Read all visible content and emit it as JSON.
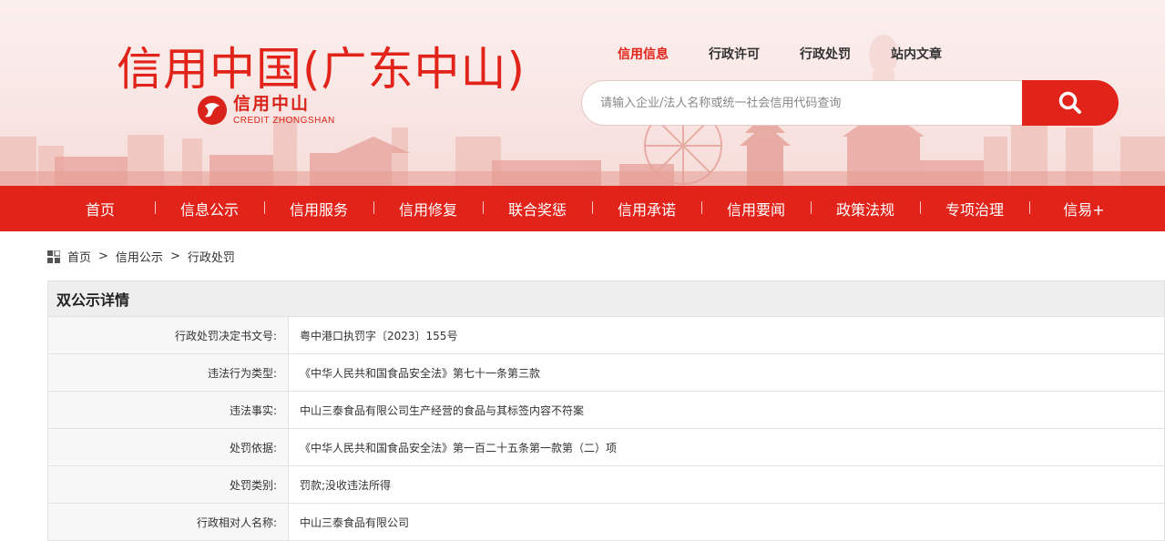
{
  "site": {
    "title": "信用中国(广东中山)",
    "logo_cn": "信用中山",
    "logo_en": "CREDIT ZHONGSHAN"
  },
  "top_nav": [
    {
      "label": "信用信息",
      "active": true
    },
    {
      "label": "行政许可",
      "active": false
    },
    {
      "label": "行政处罚",
      "active": false
    },
    {
      "label": "站内文章",
      "active": false
    }
  ],
  "search": {
    "placeholder": "请输入企业/法人名称或统一社会信用代码查询",
    "icon": "search-icon"
  },
  "main_nav": [
    "首页",
    "信息公示",
    "信用服务",
    "信用修复",
    "联合奖惩",
    "信用承诺",
    "信用要闻",
    "政策法规",
    "专项治理",
    "信易+"
  ],
  "breadcrumb": [
    "首页",
    "信用公示",
    "行政处罚"
  ],
  "detail": {
    "title": "双公示详情",
    "rows": [
      {
        "label": "行政处罚决定书文号:",
        "value": "粤中港口执罚字〔2023〕155号"
      },
      {
        "label": "违法行为类型:",
        "value": "《中华人民共和国食品安全法》第七十一条第三款"
      },
      {
        "label": "违法事实:",
        "value": "中山三泰食品有限公司生产经营的食品与其标签内容不符案"
      },
      {
        "label": "处罚依据:",
        "value": "《中华人民共和国食品安全法》第一百二十五条第一款第（二）项"
      },
      {
        "label": "处罚类别:",
        "value": "罚款;没收违法所得"
      },
      {
        "label": "行政相对人名称:",
        "value": "中山三泰食品有限公司"
      }
    ]
  },
  "colors": {
    "brand_red": "#e2231a",
    "banner_bg": "#f9e8e6",
    "header_gray": "#eeeeee"
  }
}
